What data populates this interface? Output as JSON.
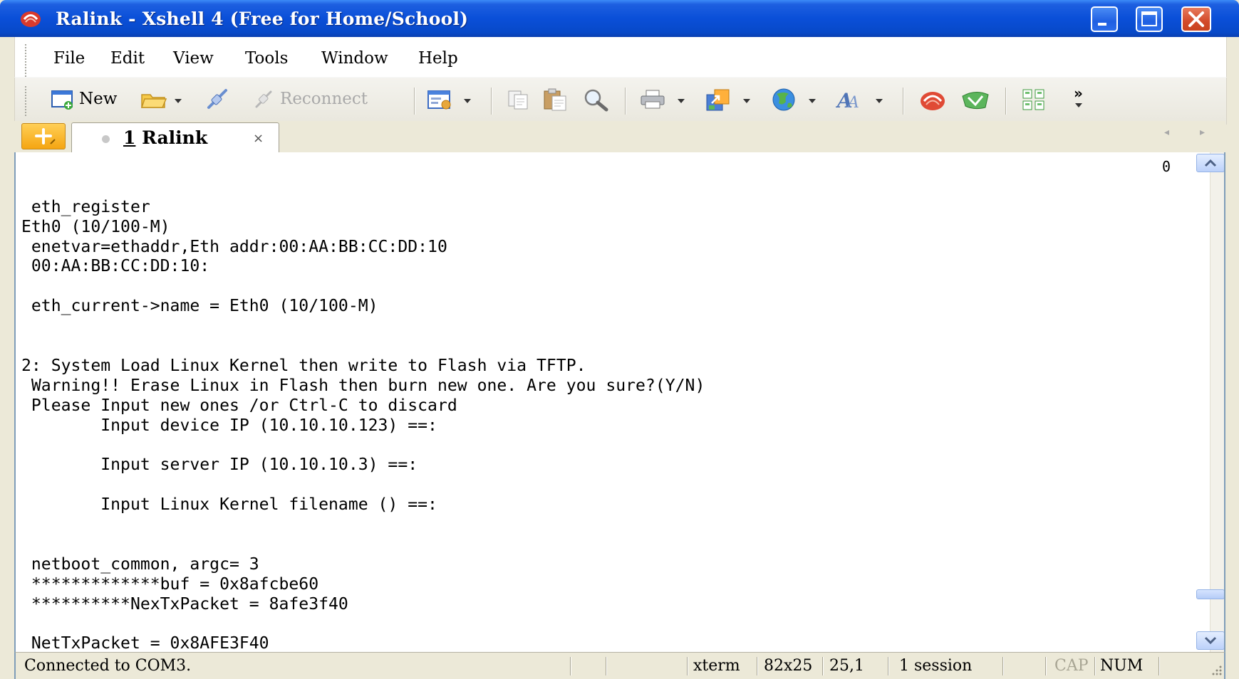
{
  "window": {
    "title": "Ralink - Xshell 4 (Free for Home/School)"
  },
  "menu": {
    "items": [
      "File",
      "Edit",
      "View",
      "Tools",
      "Window",
      "Help"
    ]
  },
  "toolbar": {
    "new_label": "New",
    "reconnect_label": "Reconnect",
    "overflow_label": "»"
  },
  "tabs": {
    "active": {
      "number": "1",
      "name": "Ralink",
      "close_glyph": "×"
    },
    "nav_prev": "◂",
    "nav_next": "▸"
  },
  "terminal": {
    "corner_counter": "0",
    "lines": [
      "",
      "",
      " eth_register",
      "Eth0 (10/100-M)",
      " enetvar=ethaddr,Eth addr:00:AA:BB:CC:DD:10",
      " 00:AA:BB:CC:DD:10:",
      "",
      " eth_current->name = Eth0 (10/100-M)",
      "",
      "",
      "2: System Load Linux Kernel then write to Flash via TFTP.",
      " Warning!! Erase Linux in Flash then burn new one. Are you sure?(Y/N)",
      " Please Input new ones /or Ctrl-C to discard",
      "        Input device IP (10.10.10.123) ==:",
      "",
      "        Input server IP (10.10.10.3) ==:",
      "",
      "        Input Linux Kernel filename () ==:",
      "",
      "",
      " netboot_common, argc= 3",
      " *************buf = 0x8afcbe60",
      " **********NexTxPacket = 8afe3f40",
      "",
      " NetTxPacket = 0x8AFE3F40"
    ]
  },
  "status": {
    "connection": "Connected to COM3.",
    "terminal_type": "xterm",
    "size": "82x25",
    "cursor": "25,1",
    "sessions": "1 session",
    "cap": "CAP",
    "num": "NUM"
  },
  "colors": {
    "titlebar": "#0a4fd8",
    "close_button": "#d24a2a",
    "terminal_bg": "#ffffff",
    "chrome": "#ece9d8"
  }
}
